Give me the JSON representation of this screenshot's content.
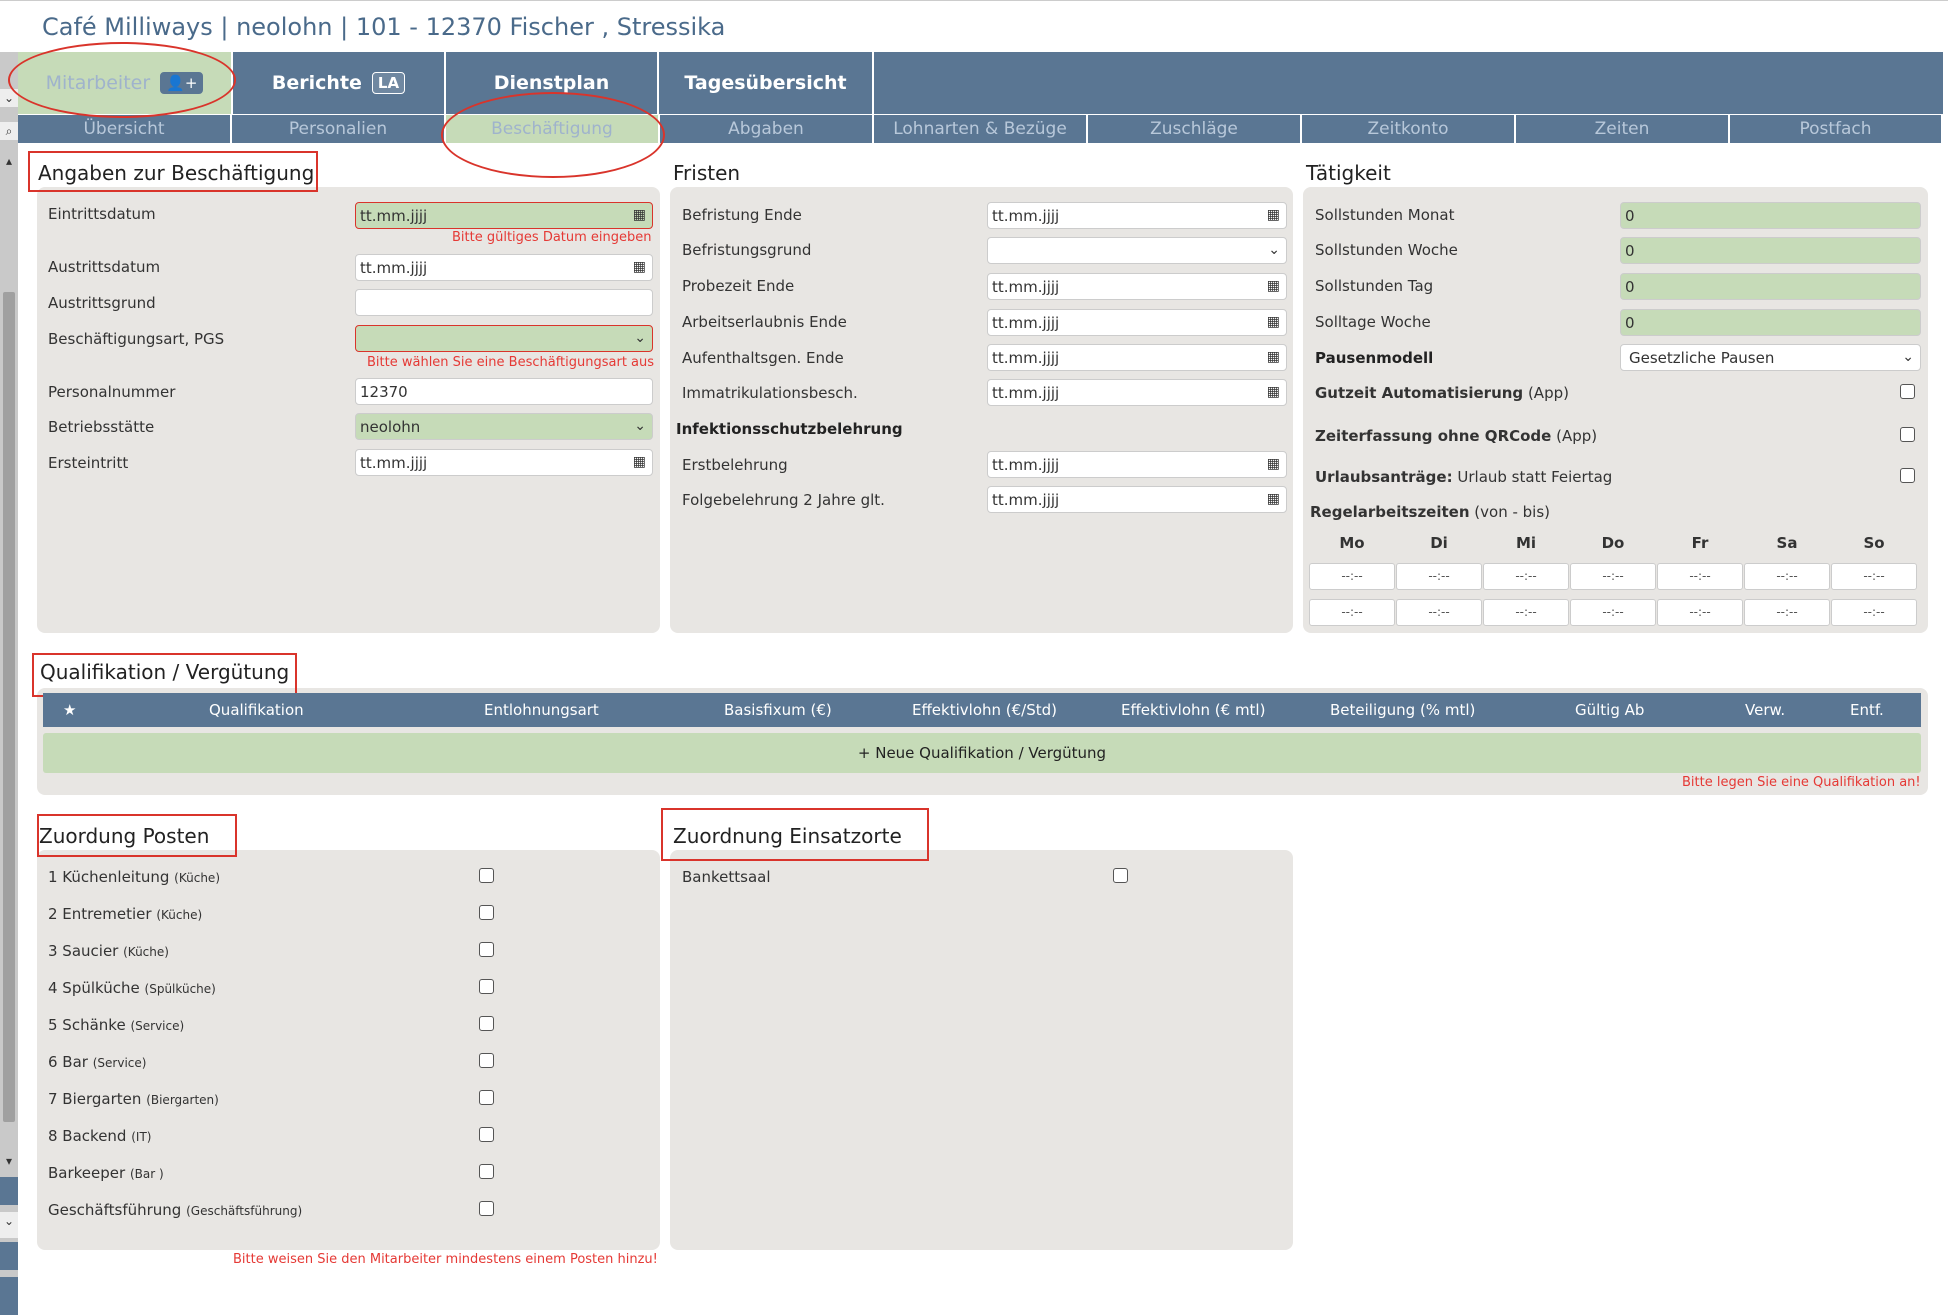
{
  "title": "Café Milliways | neolohn | 101 - 12370 Fischer , Stressika",
  "topnav": {
    "tabs": [
      {
        "label": "Mitarbeiter"
      },
      {
        "label": "Berichte",
        "badge": "LA"
      },
      {
        "label": "Dienstplan"
      },
      {
        "label": "Tagesübersicht"
      }
    ]
  },
  "subnav": [
    "Übersicht",
    "Personalien",
    "Beschäftigung",
    "Abgaben",
    "Lohnarten & Bezüge",
    "Zuschläge",
    "Zeitkonto",
    "Zeiten",
    "Postfach"
  ],
  "employment": {
    "heading": "Angaben zur Beschäftigung",
    "eintritt_label": "Eintrittsdatum",
    "eintritt_value": "tt.mm.jjjj",
    "eintritt_error": "Bitte gültiges Datum eingeben",
    "austritt_label": "Austrittsdatum",
    "austritt_value": "tt.mm.jjjj",
    "austrittsgrund_label": "Austrittsgrund",
    "art_label": "Beschäftigungsart, PGS",
    "art_error": "Bitte wählen Sie eine Beschäftigungsart aus",
    "pnr_label": "Personalnummer",
    "pnr_value": "12370",
    "betrieb_label": "Betriebsstätte",
    "betrieb_value": "neolohn",
    "erst_label": "Ersteintritt",
    "erst_value": "tt.mm.jjjj"
  },
  "fristen": {
    "heading": "Fristen",
    "befristung_ende": "Befristung Ende",
    "befristungsgrund": "Befristungsgrund",
    "probezeit": "Probezeit Ende",
    "arbeitserlaubnis": "Arbeitserlaubnis Ende",
    "aufenthalt": "Aufenthaltsgen. Ende",
    "immatrikulation": "Immatrikulationsbesch.",
    "infektion": "Infektionsschutzbelehrung",
    "erstbelehrung": "Erstbelehrung",
    "folgebelehrung": "Folgebelehrung 2 Jahre glt.",
    "date_placeholder": "tt.mm.jjjj"
  },
  "taetigkeit": {
    "heading": "Tätigkeit",
    "soll_monat": "Sollstunden Monat",
    "soll_monat_v": "0",
    "soll_woche": "Sollstunden Woche",
    "soll_woche_v": "0",
    "soll_tag": "Sollstunden Tag",
    "soll_tag_v": "0",
    "solltage": "Solltage Woche",
    "solltage_v": "0",
    "pausen": "Pausenmodell",
    "pausen_v": "Gesetzliche Pausen",
    "gutzeit": "Gutzeit Automatisierung",
    "app": "(App)",
    "zeiterfassung": "Zeiterfassung ohne QRCode",
    "urlaub_b": "Urlaubsanträge:",
    "urlaub": "Urlaub statt Feiertag",
    "regel_b": "Regelarbeitszeiten",
    "regel": "(von - bis)",
    "days": [
      "Mo",
      "Di",
      "Mi",
      "Do",
      "Fr",
      "Sa",
      "So"
    ],
    "time_placeholder": "--:--"
  },
  "qualifikation": {
    "heading": "Qualifikation / Vergütung",
    "star": "★",
    "cols": [
      "Qualifikation",
      "Entlohnungsart",
      "Basisfixum (€)",
      "Effektivlohn (€/Std)",
      "Effektivlohn (€ mtl)",
      "Beteiligung (% mtl)",
      "Gültig Ab",
      "Verw.",
      "Entf."
    ],
    "new_button": "+ Neue Qualifikation / Vergütung",
    "error": "Bitte legen Sie eine Qualifikation an!"
  },
  "posten": {
    "heading": "Zuordung Posten",
    "items": [
      {
        "name": "1 Küchenleitung",
        "sub": "(Küche)"
      },
      {
        "name": "2 Entremetier",
        "sub": "(Küche)"
      },
      {
        "name": "3 Saucier",
        "sub": "(Küche)"
      },
      {
        "name": "4 Spülküche",
        "sub": "(Spülküche)"
      },
      {
        "name": "5 Schänke",
        "sub": "(Service)"
      },
      {
        "name": "6 Bar",
        "sub": "(Service)"
      },
      {
        "name": "7 Biergarten",
        "sub": "(Biergarten)"
      },
      {
        "name": "8 Backend",
        "sub": "(IT)"
      },
      {
        "name": "Barkeeper",
        "sub": "(Bar )"
      },
      {
        "name": "Geschäftsführung",
        "sub": "(Geschäftsführung)"
      }
    ],
    "error": "Bitte weisen Sie den Mitarbeiter mindestens einem Posten hinzu!"
  },
  "einsatzorte": {
    "heading": "Zuordnung Einsatzorte",
    "items": [
      "Bankettsaal"
    ]
  }
}
